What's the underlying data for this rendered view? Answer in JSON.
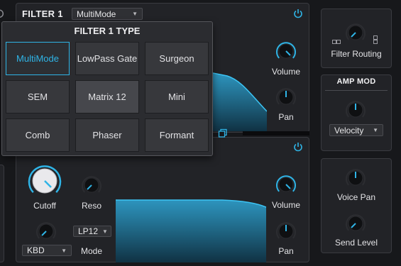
{
  "filter1": {
    "title": "FILTER 1",
    "mode_value": "MultiMode",
    "volume_label": "Volume",
    "pan_label": "Pan"
  },
  "filter1_type_popup": {
    "title": "FILTER 1 TYPE",
    "options": [
      "MultiMode",
      "LowPass Gate",
      "Surgeon",
      "SEM",
      "Matrix 12",
      "Mini",
      "Comb",
      "Phaser",
      "Formant"
    ],
    "selected": "MultiMode"
  },
  "filter2": {
    "cutoff_label": "Cutoff",
    "reso_label": "Reso",
    "kbd_value": "KBD",
    "mode_value": "LP12",
    "mode_label": "Mode",
    "volume_label": "Volume",
    "pan_label": "Pan"
  },
  "right_column": {
    "filter_routing_label": "Filter Routing",
    "amp_mod_title": "AMP MOD",
    "amp_mod_source": "Velocity",
    "voice_pan_label": "Voice Pan",
    "send_level_label": "Send Level"
  },
  "colors": {
    "accent": "#2fb4e6",
    "background": "#17181b",
    "panel": "#222327"
  },
  "icons": [
    "power-icon",
    "copy-icon",
    "chevron-down-icon",
    "knob-icon"
  ]
}
